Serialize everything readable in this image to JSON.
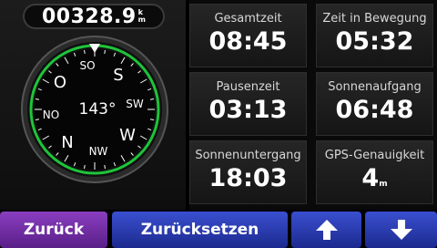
{
  "odometer": {
    "value": "00328.9",
    "unit_top": "k",
    "unit_bottom": "m"
  },
  "compass": {
    "heading_text": "143°",
    "labels": {
      "n": "N",
      "nw": "NW",
      "w": "W",
      "sw": "SW",
      "s": "S",
      "so": "SO",
      "o": "O",
      "no": "NO"
    },
    "ring_color": "#1ec43a"
  },
  "tiles": [
    {
      "label": "Gesamtzeit",
      "value": "08:45",
      "unit": ""
    },
    {
      "label": "Zeit in Bewegung",
      "value": "05:32",
      "unit": ""
    },
    {
      "label": "Pausenzeit",
      "value": "03:13",
      "unit": ""
    },
    {
      "label": "Sonnenaufgang",
      "value": "06:48",
      "unit": ""
    },
    {
      "label": "Sonnenuntergang",
      "value": "18:03",
      "unit": ""
    },
    {
      "label": "GPS-Genauigkeit",
      "value": "4",
      "unit": "m"
    }
  ],
  "buttons": {
    "back": "Zurück",
    "reset": "Zurücksetzen",
    "up_icon": "arrow-up-icon",
    "down_icon": "arrow-down-icon"
  }
}
